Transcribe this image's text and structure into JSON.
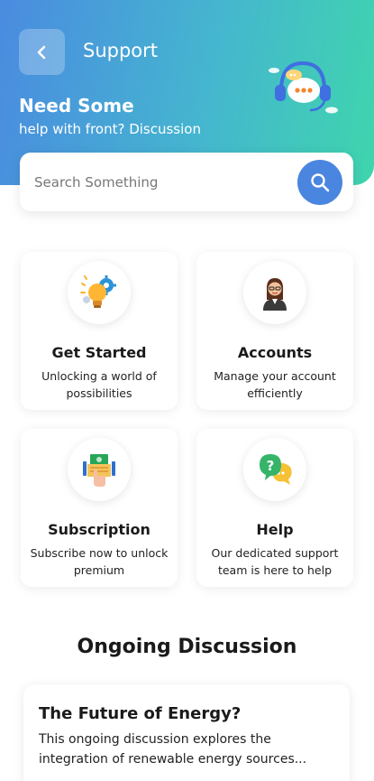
{
  "header": {
    "title": "Support",
    "headline": "Need Some",
    "subtitle": "help with front? Discussion"
  },
  "search": {
    "placeholder": "Search Something"
  },
  "categories": [
    {
      "title": "Get Started",
      "description": "Unlocking a world of possibilities",
      "icon": "lightbulb-gear-icon"
    },
    {
      "title": "Accounts",
      "description": "Manage your account efficiently",
      "icon": "user-avatar-icon"
    },
    {
      "title": "Subscription",
      "description": "Subscribe now to unlock premium",
      "icon": "money-hand-icon"
    },
    {
      "title": "Help",
      "description": "Our dedicated support team is here to help",
      "icon": "chat-question-icon"
    }
  ],
  "discussion": {
    "section_title": "Ongoing Discussion",
    "items": [
      {
        "title": "The Future of Energy?",
        "excerpt": "This ongoing discussion explores the integration of renewable energy sources..."
      }
    ]
  },
  "colors": {
    "gradient_start": "#4a8be0",
    "gradient_end": "#3fd5ad",
    "accent": "#4a86df"
  }
}
